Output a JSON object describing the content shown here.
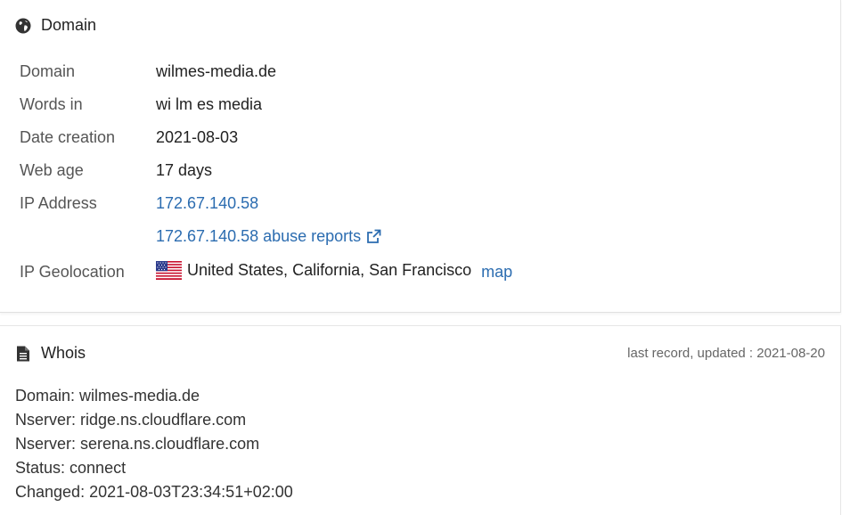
{
  "domain_panel": {
    "title": "Domain",
    "icon": "globe-icon",
    "rows": {
      "domain": {
        "label": "Domain",
        "value": "wilmes-media.de"
      },
      "words": {
        "label": "Words in",
        "value": "wi lm es media"
      },
      "date_creation": {
        "label": "Date creation",
        "value": "2021-08-03"
      },
      "web_age": {
        "label": "Web age",
        "value": "17 days"
      },
      "ip_address": {
        "label": "IP Address",
        "value": "172.67.140.58"
      },
      "abuse": {
        "value": "172.67.140.58 abuse reports"
      },
      "geolocation": {
        "label": "IP Geolocation",
        "value": "United States, California, San Francisco",
        "map_link": "map"
      }
    }
  },
  "whois_panel": {
    "title": "Whois",
    "icon": "file-text-icon",
    "updated": "last record, updated : 2021-08-20",
    "lines": [
      "Domain: wilmes-media.de",
      "Nserver: ridge.ns.cloudflare.com",
      "Nserver: serena.ns.cloudflare.com",
      "Status: connect",
      "Changed: 2021-08-03T23:34:51+02:00"
    ]
  },
  "colors": {
    "link": "#2b6cb0",
    "label": "#555555",
    "text": "#222222"
  }
}
